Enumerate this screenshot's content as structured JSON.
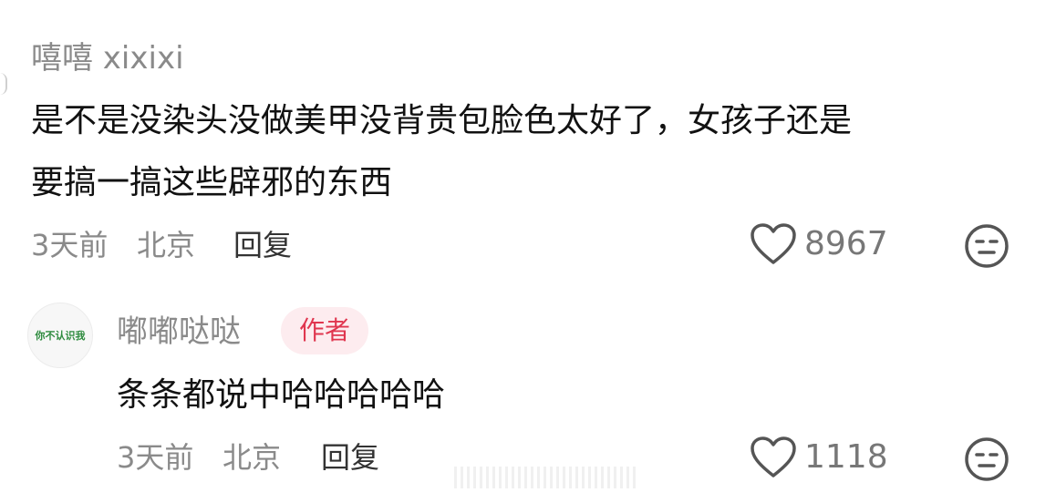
{
  "comments": [
    {
      "username": "嘻嘻 xixixi",
      "content_lines": [
        "是不是没染头没做美甲没背贵包脸色太好了，女孩子还是",
        "要搞一搞这些辟邪的东西"
      ],
      "time": "3天前",
      "location": "北京",
      "reply_label": "回复",
      "like_count": "8967",
      "like_icon": "heart-outline-icon",
      "dislike_icon": "meh-face-icon"
    },
    {
      "username": "嘟嘟哒哒",
      "author_badge": "作者",
      "avatar_text": "你不认识我",
      "content_lines": [
        "条条都说中哈哈哈哈哈"
      ],
      "time": "3天前",
      "location": "北京",
      "reply_label": "回复",
      "like_count": "1118",
      "like_icon": "heart-outline-icon",
      "dislike_icon": "meh-face-icon"
    }
  ],
  "colors": {
    "username": "#8a8a8a",
    "content": "#111111",
    "meta": "#8a8a8a",
    "author_badge_bg": "#fdecef",
    "author_badge_text": "#e0364f",
    "avatar_text": "#2e8b3e"
  }
}
